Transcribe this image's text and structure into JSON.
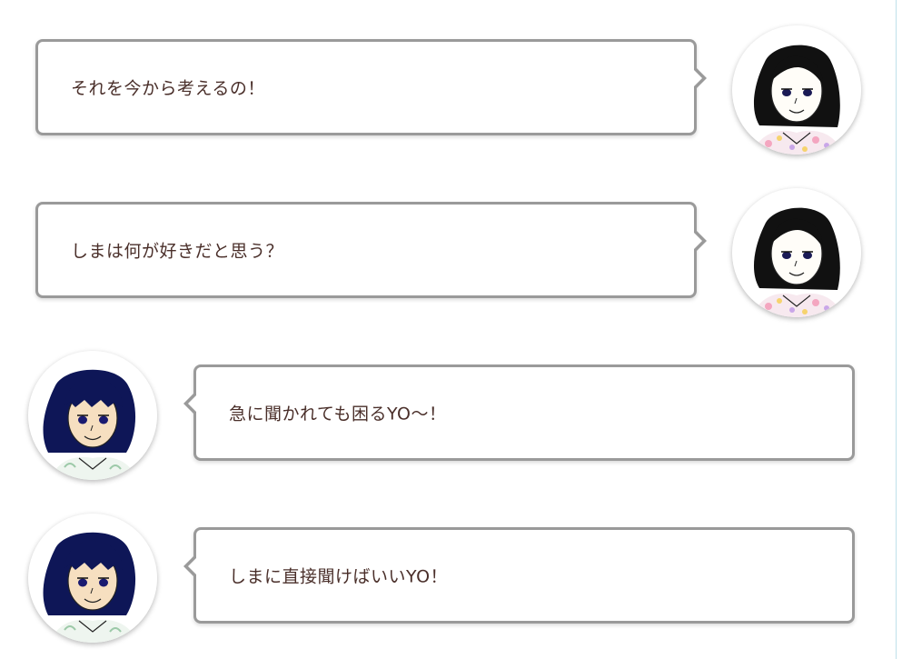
{
  "messages": [
    {
      "text": "それを今から考えるの！",
      "side": "right",
      "speaker_avatar": "woman-black-hair-avatar"
    },
    {
      "text": "しまは何が好きだと思う？",
      "side": "right",
      "speaker_avatar": "woman-black-hair-avatar"
    },
    {
      "text": "急に聞かれても困るYO〜！",
      "side": "left",
      "speaker_avatar": "girl-navy-hair-avatar"
    },
    {
      "text": "しまに直接聞けばいいYO！",
      "side": "left",
      "speaker_avatar": "girl-navy-hair-avatar"
    }
  ],
  "colors": {
    "bubble_border": "#9a9a9a",
    "text": "#4a2f2a",
    "hair_black": "#111111",
    "hair_navy": "#0e1657",
    "skin_light": "#fffdf8",
    "skin_tan": "#f6dfc0",
    "accent_rule": "#bfe0ea"
  }
}
